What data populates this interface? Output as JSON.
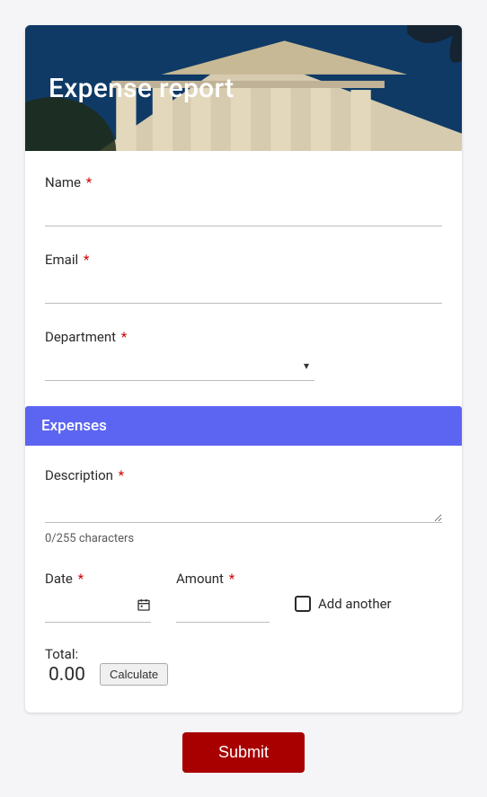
{
  "header": {
    "title": "Expense report"
  },
  "fields": {
    "name": {
      "label": "Name",
      "value": ""
    },
    "email": {
      "label": "Email",
      "value": ""
    },
    "department": {
      "label": "Department",
      "selected": ""
    }
  },
  "section": {
    "title": "Expenses"
  },
  "expense": {
    "description": {
      "label": "Description",
      "value": "",
      "helper": "0/255 characters"
    },
    "date": {
      "label": "Date",
      "value": ""
    },
    "amount": {
      "label": "Amount",
      "value": ""
    },
    "add_another": {
      "label": "Add another",
      "checked": false
    }
  },
  "total": {
    "label": "Total:",
    "value": "0.00",
    "calculate": "Calculate"
  },
  "submit": {
    "label": "Submit"
  },
  "required_marker": "*"
}
